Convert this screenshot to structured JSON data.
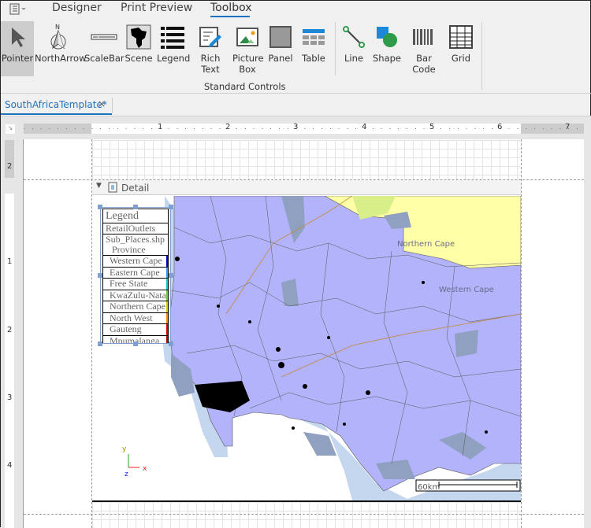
{
  "ribbon": {
    "tabs": [
      {
        "label": "Designer"
      },
      {
        "label": "Print Preview"
      },
      {
        "label": "Toolbox",
        "active": true
      }
    ],
    "tools": [
      {
        "label": "Pointer",
        "icon": "pointer-icon"
      },
      {
        "label": "NorthArrow",
        "icon": "north-arrow-icon"
      },
      {
        "label": "ScaleBar",
        "icon": "scale-bar-icon"
      },
      {
        "label": "Scene",
        "icon": "africa-map-icon"
      },
      {
        "label": "Legend",
        "icon": "legend-list-icon"
      },
      {
        "label": "Rich Text",
        "icon": "rich-text-icon"
      },
      {
        "label": "Picture Box",
        "icon": "picture-icon"
      },
      {
        "label": "Panel",
        "icon": "panel-icon"
      },
      {
        "label": "Table",
        "icon": "table-icon"
      },
      {
        "label": "Line",
        "icon": "line-icon"
      },
      {
        "label": "Shape",
        "icon": "shape-icon"
      },
      {
        "label": "Bar Code",
        "icon": "barcode-icon"
      },
      {
        "label": "Grid",
        "icon": "grid-icon"
      }
    ],
    "group_label": "Standard Controls",
    "north_letter": "N"
  },
  "document_tab": {
    "label": "SouthAfricaTemplate*",
    "close": "×"
  },
  "ruler": {
    "h": [
      "1",
      "2",
      "3",
      "4",
      "5",
      "6",
      "7"
    ],
    "v": [
      "2",
      "1",
      "2",
      "3",
      "4"
    ]
  },
  "band": {
    "label": "Detail"
  },
  "legend": {
    "title": "Legend",
    "items": [
      {
        "label": "RetailOutlets"
      },
      {
        "label": "Sub_Places.shp"
      },
      {
        "label": "Province"
      },
      {
        "label": "Western Cape",
        "color": "#0000cc"
      },
      {
        "label": "Eastern Cape",
        "color": "#3399ff"
      },
      {
        "label": "Free State",
        "color": "#00cccc"
      },
      {
        "label": "KwaZulu-Natal",
        "color": "#66cc33"
      },
      {
        "label": "Northern Cape",
        "color": "#cccc00"
      },
      {
        "label": "North West",
        "color": "#ff8800"
      },
      {
        "label": "Gauteng",
        "color": "#dd0000"
      },
      {
        "label": "Mpumalanga",
        "color": "#aa0000"
      }
    ]
  },
  "map": {
    "labels": {
      "northern_cape": "Northern Cape",
      "western_cape": "Western Cape"
    },
    "scalebar": "60km",
    "axes": {
      "x": "x",
      "y": "y",
      "z": "z"
    },
    "colors": {
      "land": "#b3b3fb",
      "ocean": "#c5d7ee",
      "northern_cape": "#ffffa8",
      "shade": "#8fa0c0"
    }
  },
  "colors": {
    "accent": "#1e73be"
  }
}
